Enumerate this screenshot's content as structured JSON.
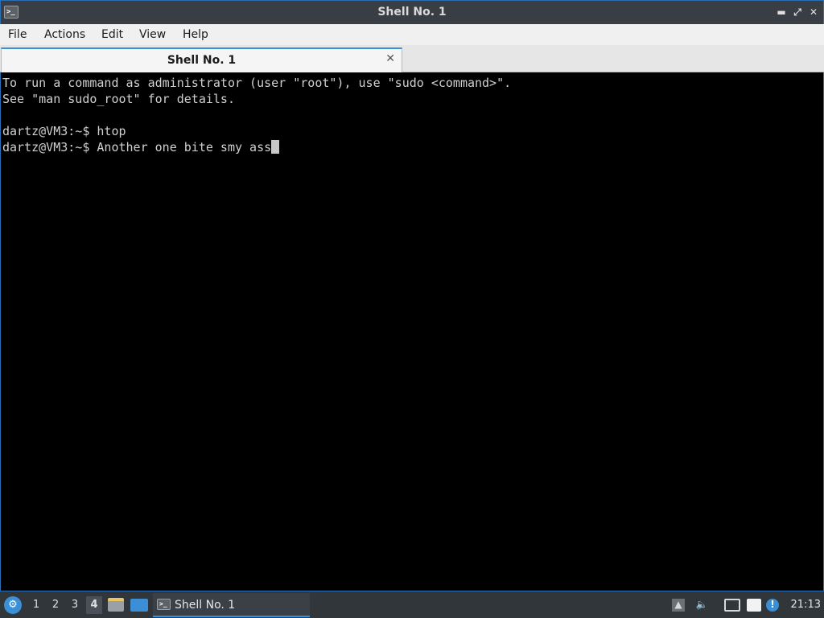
{
  "window": {
    "title": "Shell No. 1",
    "app_icon_glyph": ">_",
    "minimize_glyph": "▬",
    "maximize_glyph": "⤢",
    "close_glyph": "✕"
  },
  "menubar": {
    "items": [
      "File",
      "Actions",
      "Edit",
      "View",
      "Help"
    ]
  },
  "tabs": [
    {
      "label": "Shell No. 1",
      "close_glyph": "✕"
    }
  ],
  "terminal": {
    "lines": [
      "To run a command as administrator (user \"root\"), use \"sudo <command>\".",
      "See \"man sudo_root\" for details.",
      "",
      "dartz@VM3:~$ htop",
      "dartz@VM3:~$ Another one bite smy ass"
    ]
  },
  "taskbar": {
    "start_glyph": "⚙",
    "desktops": [
      "1",
      "2",
      "3",
      "4"
    ],
    "active_desktop": "4",
    "window_button_label": "Shell No. 1",
    "window_button_icon_glyph": ">_",
    "tray_icons": [
      "up-arrow-icon",
      "volume-icon",
      "network-icon",
      "clipboard-icon",
      "update-notifier-icon"
    ],
    "clock": "21:13"
  },
  "colors": {
    "accent": "#3a8fd6",
    "terminal_bg": "#000000",
    "terminal_fg": "#d0d0d0",
    "titlebar_bg": "#393e44",
    "taskbar_bg": "#31363b"
  }
}
